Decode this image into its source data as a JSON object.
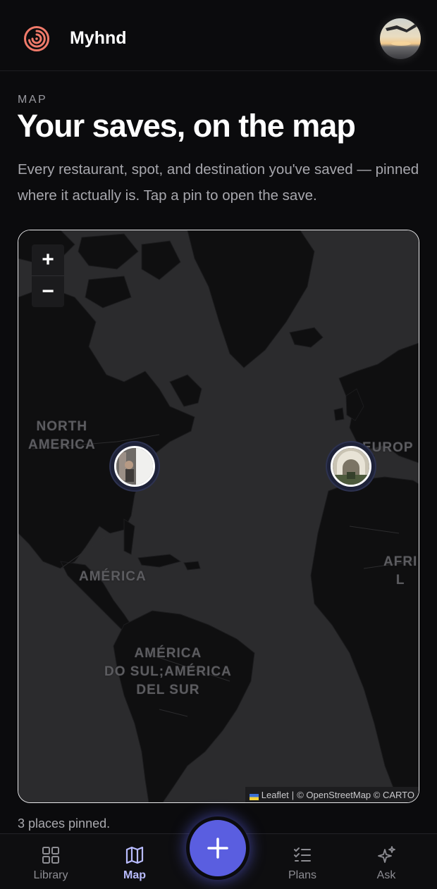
{
  "app": {
    "name": "Myhnd"
  },
  "header": {
    "logo_icon": "spiral-logo-icon",
    "avatar_icon": "user-avatar"
  },
  "page": {
    "eyebrow": "MAP",
    "title": "Your saves, on the map",
    "subtitle": "Every restaurant, spot, and destination you've saved — pinned where it actually is. Tap a pin to open the save."
  },
  "map": {
    "zoom_in": "+",
    "zoom_out": "−",
    "labels": {
      "north_america_1": "NORTH",
      "north_america_2": "AMERICA",
      "europe": "EUROP",
      "africa_1": "AFRI",
      "africa_2": "L",
      "america": "AMÉRICA",
      "south_1": "AMÉRICA",
      "south_2": "DO SUL;AMÉRICA",
      "south_3": "DEL SUR"
    },
    "attribution": {
      "leaflet": "Leaflet",
      "separator": "|",
      "credits": "© OpenStreetMap © CARTO"
    }
  },
  "footer": {
    "pinned_count": "3 places pinned."
  },
  "tabs": [
    {
      "label": "Library",
      "icon": "grid-icon"
    },
    {
      "label": "Map",
      "icon": "map-icon",
      "active": true
    },
    {
      "label": "Plans",
      "icon": "checklist-icon"
    },
    {
      "label": "Ask",
      "icon": "sparkles-icon"
    }
  ],
  "fab": {
    "icon": "plus-icon"
  },
  "colors": {
    "accent": "#5a5ee0",
    "background": "#0b0b0d",
    "map_land": "#0f0f10",
    "map_sea": "#2b2b2d",
    "logo": "#f07a6a"
  }
}
